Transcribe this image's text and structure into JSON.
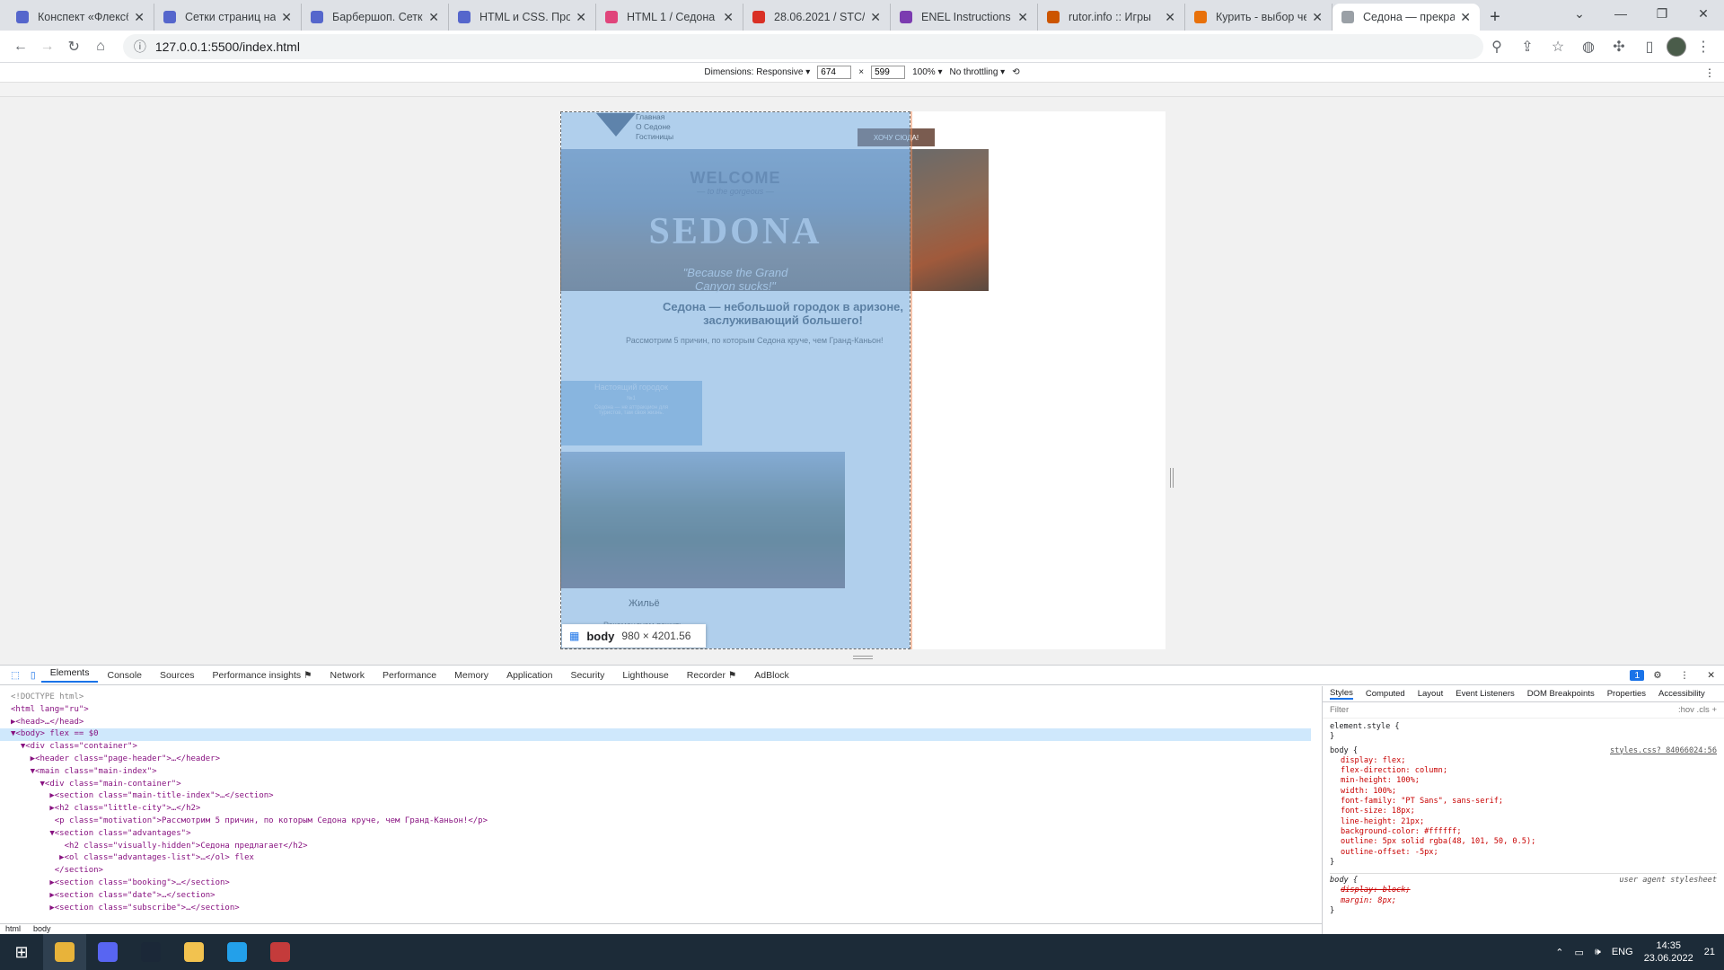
{
  "browser": {
    "tabs": [
      {
        "title": "Конспект «Флексб",
        "color": "#5566cc"
      },
      {
        "title": "Сетки страниц на",
        "color": "#5566cc"
      },
      {
        "title": "Барбершоп. Сетка",
        "color": "#5566cc"
      },
      {
        "title": "HTML и CSS. Проф",
        "color": "#5566cc"
      },
      {
        "title": "HTML 1 / Седона",
        "color": "#e0457b"
      },
      {
        "title": "28.06.2021 / STC/",
        "color": "#d93025"
      },
      {
        "title": "ENEL Instructions",
        "color": "#7b3bb0"
      },
      {
        "title": "rutor.info :: Игры",
        "color": "#cc5500"
      },
      {
        "title": "Курить - выбор че",
        "color": "#e8710a"
      },
      {
        "title": "Седона — прекра",
        "color": "#9aa0a6"
      }
    ],
    "active_tab_index": 9,
    "url": "127.0.0.1:5500/index.html"
  },
  "device_toolbar": {
    "dimensions_label": "Dimensions: Responsive ▾",
    "width": "674",
    "height": "599",
    "times": "×",
    "zoom": "100% ▾",
    "throttle": "No throttling ▾"
  },
  "page": {
    "nav": [
      "Главная",
      "О Седоне",
      "Гостиницы"
    ],
    "want_button": "ХОЧУ СЮДА!",
    "hero_welcome": "WELCOME",
    "hero_to": "— to the gorgeous —",
    "hero_title": "SEDONA",
    "hero_tagline_1": "\"Because the Grand",
    "hero_tagline_2": "Canyon sucks!\"",
    "subtitle": "Седона — небольшой городок в аризоне, заслуживающий большего!",
    "motivation": "Рассмотрим 5 причин, по которым Седона круче, чем Гранд-Каньон!",
    "advantage_title": "Настоящий городок",
    "advantage_num": "№1",
    "advantage_text": "Седона — не аттракцион для туристов, там своя жизнь.",
    "housing_title": "Жильё",
    "housing_sub": "Рекомендуем пожить",
    "inspect_tag": "body",
    "inspect_dims": "980 × 4201.56"
  },
  "devtools": {
    "tabs": [
      "Elements",
      "Console",
      "Sources",
      "Performance insights ⚑",
      "Network",
      "Performance",
      "Memory",
      "Application",
      "Security",
      "Lighthouse",
      "Recorder ⚑",
      "AdBlock"
    ],
    "active_tab": "Elements",
    "issues_badge": "1",
    "dom_lines": [
      "<!DOCTYPE html>",
      "<html lang=\"ru\">",
      "▶<head>…</head>",
      "▼<body> flex == $0",
      "  ▼<div class=\"container\">",
      "    ▶<header class=\"page-header\">…</header>",
      "    ▼<main class=\"main-index\">",
      "      ▼<div class=\"main-container\">",
      "        ▶<section class=\"main-title-index\">…</section>",
      "        ▶<h2 class=\"little-city\">…</h2>",
      "         <p class=\"motivation\">Рассмотрим 5 причин, по которым Седона круче, чем Гранд-Каньон!</p>",
      "        ▼<section class=\"advantages\">",
      "           <h2 class=\"visually-hidden\">Седона предлагает</h2>",
      "          ▶<ol class=\"advantages-list\">…</ol> flex",
      "         </section>",
      "        ▶<section class=\"booking\">…</section>",
      "        ▶<section class=\"date\">…</section>",
      "        ▶<section class=\"subscribe\">…</section>"
    ],
    "selected_line": 3,
    "breadcrumbs": [
      "html",
      "body"
    ],
    "styles_tabs": [
      "Styles",
      "Computed",
      "Layout",
      "Event Listeners",
      "DOM Breakpoints",
      "Properties",
      "Accessibility"
    ],
    "filter_placeholder": "Filter",
    "filter_tools": ":hov  .cls  +",
    "rule_element_style": "element.style {",
    "rule_close": "}",
    "rule_body_selector": "body {",
    "rule_body_source": "styles.css?_84066024:56",
    "rule_body_props": [
      "display: flex;",
      "flex-direction: column;",
      "min-height: 100%;",
      "width: 100%;",
      "font-family: \"PT Sans\", sans-serif;",
      "font-size: 18px;",
      "line-height: 21px;",
      "background-color: #ffffff;",
      "outline: 5px solid rgba(48, 101, 50, 0.5);",
      "outline-offset: -5px;"
    ],
    "rule_ua_selector": "body {",
    "rule_ua_source": "user agent stylesheet",
    "rule_ua_props": [
      "display: block;",
      "margin: 8px;"
    ]
  },
  "taskbar": {
    "apps": [
      {
        "name": "chrome",
        "color": "#e8b33a"
      },
      {
        "name": "discord",
        "color": "#5865f2"
      },
      {
        "name": "steam",
        "color": "#1b2838"
      },
      {
        "name": "explorer",
        "color": "#f2c24f"
      },
      {
        "name": "vscode",
        "color": "#23a0ea"
      },
      {
        "name": "calculator",
        "color": "#c43b3b"
      }
    ],
    "lang": "ENG",
    "time": "14:35",
    "date": "23.06.2022",
    "notifications": "21"
  }
}
